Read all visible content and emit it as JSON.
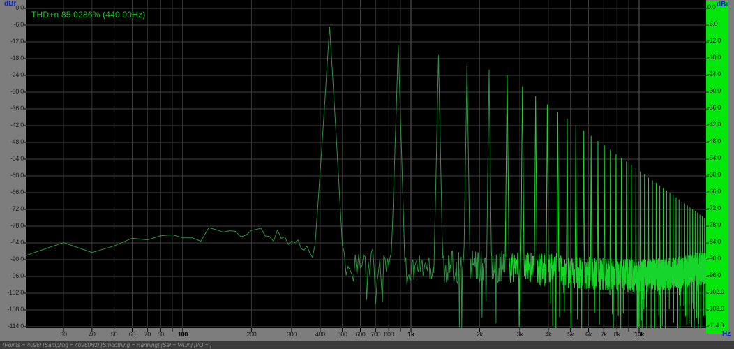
{
  "units": {
    "left_axis": "dBr",
    "right_axis": "dBr",
    "freq_axis": "Hz"
  },
  "annotation": {
    "thd_readout": "THD+n 85.0286% (440.00Hz)"
  },
  "y_axis": {
    "step_db": 6,
    "labels": [
      "0.0",
      "-6.0",
      "-12.0",
      "-18.0",
      "-24.0",
      "-30.0",
      "-36.0",
      "-42.0",
      "-48.0",
      "-54.0",
      "-60.0",
      "-66.0",
      "-72.0",
      "-78.0",
      "-84.0",
      "-90.0",
      "-96.0",
      "-102.0",
      "-108.0",
      "-114.0"
    ]
  },
  "x_axis": {
    "ticks": [
      {
        "label": "30",
        "f": 30,
        "bold": false
      },
      {
        "label": "40",
        "f": 40,
        "bold": false
      },
      {
        "label": "50",
        "f": 50,
        "bold": false
      },
      {
        "label": "60",
        "f": 60,
        "bold": false
      },
      {
        "label": "70",
        "f": 70,
        "bold": false
      },
      {
        "label": "80",
        "f": 80,
        "bold": false
      },
      {
        "label": "100",
        "f": 100,
        "bold": true
      },
      {
        "label": "200",
        "f": 200,
        "bold": false
      },
      {
        "label": "300",
        "f": 300,
        "bold": false
      },
      {
        "label": "400",
        "f": 400,
        "bold": false
      },
      {
        "label": "500",
        "f": 500,
        "bold": false
      },
      {
        "label": "600",
        "f": 600,
        "bold": false
      },
      {
        "label": "700",
        "f": 700,
        "bold": false
      },
      {
        "label": "800",
        "f": 800,
        "bold": false
      },
      {
        "label": "1k",
        "f": 1000,
        "bold": true
      },
      {
        "label": "2k",
        "f": 2000,
        "bold": false
      },
      {
        "label": "3k",
        "f": 3000,
        "bold": false
      },
      {
        "label": "4k",
        "f": 4000,
        "bold": false
      },
      {
        "label": "5k",
        "f": 5000,
        "bold": false
      },
      {
        "label": "6k",
        "f": 6000,
        "bold": false
      },
      {
        "label": "7k",
        "f": 7000,
        "bold": false
      },
      {
        "label": "8k",
        "f": 8000,
        "bold": false
      },
      {
        "label": "10k",
        "f": 10000,
        "bold": true
      }
    ],
    "gridline_freqs": [
      30,
      40,
      50,
      60,
      70,
      80,
      90,
      100,
      200,
      300,
      400,
      500,
      600,
      700,
      800,
      900,
      1000,
      2000,
      3000,
      4000,
      5000,
      6000,
      7000,
      8000,
      9000,
      10000
    ],
    "major_freqs": [
      100,
      1000,
      10000
    ]
  },
  "status_bar": {
    "text": "[Points = 4096]  [Sampling = 40960Hz]  [Smoothing = Hanning]  [Sel = VA.in]  [I/O = ]"
  },
  "colors": {
    "plot_bg": "#000000",
    "axis_strip": "#7d7d7d",
    "grid_minor": "#383838",
    "grid_major": "#5f5f5f",
    "grid_horizontal": "#454545",
    "trace_dim": "#2f9243",
    "trace_bright": "#17d62b",
    "meter_bar": "#04e70c",
    "unit_text": "#1322cf",
    "annotation_text": "#1dc32e"
  },
  "chart_data": {
    "type": "line",
    "title": "THD+n 85.0286% (440.00Hz)",
    "xlabel": "Hz",
    "ylabel": "dBr",
    "x_scale": "log",
    "x_range_hz": [
      20.5,
      19700
    ],
    "y_range_db": [
      -114,
      0
    ],
    "grid": true,
    "fft": {
      "points": 4096,
      "sampling_hz": 40960,
      "smoothing": "Hanning",
      "bin_hz": 10
    },
    "fundamental_hz": 440,
    "thd_plus_n_percent": 85.0286,
    "harmonics_db": [
      -6.5,
      -13,
      -16.8,
      -20,
      -22,
      -24,
      -27.9,
      -31.4,
      -34.4,
      -37.1,
      -39.5,
      -41.8,
      -43.8,
      -45.7,
      -47.5,
      -49.1,
      -50.7,
      -52.2,
      -53.6,
      -54.8,
      -56.1,
      -57.3,
      -58.4,
      -59.5,
      -60.6,
      -61.6,
      -62.5,
      -63.5,
      -64.4,
      -65.2,
      -66.1,
      -66.9,
      -67.7,
      -68.4,
      -69.2,
      -69.9,
      -70.6,
      -71.3,
      -72,
      -72.6,
      -73.2,
      -73.9,
      -74.4,
      -75
    ],
    "noise_floor_db": [
      [
        20,
        -86
      ],
      [
        30,
        -83
      ],
      [
        40,
        -89
      ],
      [
        55,
        -85
      ],
      [
        70,
        -83
      ],
      [
        90,
        -80.5
      ],
      [
        120,
        -81
      ],
      [
        140,
        -78.5
      ],
      [
        170,
        -82
      ],
      [
        220,
        -80
      ],
      [
        300,
        -83
      ],
      [
        380,
        -88
      ],
      [
        450,
        -89
      ],
      [
        550,
        -93
      ],
      [
        700,
        -92
      ],
      [
        900,
        -94
      ],
      [
        1200,
        -92
      ],
      [
        1600,
        -93
      ],
      [
        2200,
        -92
      ],
      [
        3000,
        -93
      ],
      [
        4500,
        -94
      ],
      [
        7000,
        -95
      ],
      [
        10000,
        -96
      ],
      [
        14000,
        -95
      ],
      [
        19700,
        -93
      ]
    ],
    "level_meter": {
      "state": "full_scale",
      "span_db": [
        -114,
        0
      ]
    }
  }
}
